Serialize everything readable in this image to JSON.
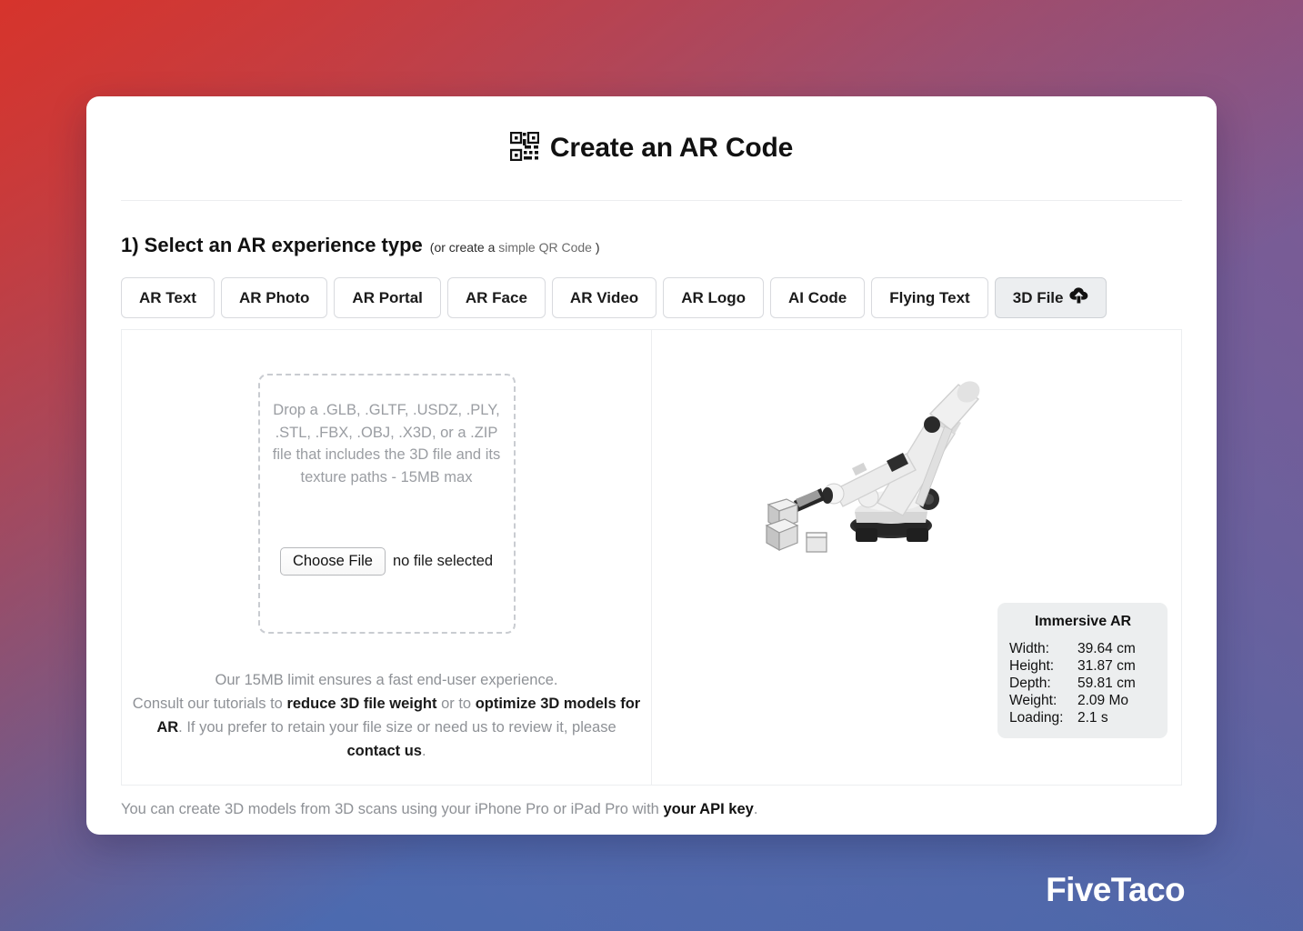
{
  "background": {
    "color_top_left": "#d6342c",
    "color_top_right": "#805891",
    "color_bottom_left": "#446ab2",
    "color_bottom_right": "#5a63a0"
  },
  "header": {
    "icon": "qr-code-icon",
    "title": "Create an AR Code"
  },
  "step": {
    "title": "1) Select an AR experience type",
    "note_prefix": "(or create a ",
    "note_link": "simple QR Code",
    "note_suffix": " )"
  },
  "tabs": [
    {
      "label": "AR Text",
      "active": false,
      "icon": null
    },
    {
      "label": "AR Photo",
      "active": false,
      "icon": null
    },
    {
      "label": "AR Portal",
      "active": false,
      "icon": null
    },
    {
      "label": "AR Face",
      "active": false,
      "icon": null
    },
    {
      "label": "AR Video",
      "active": false,
      "icon": null
    },
    {
      "label": "AR Logo",
      "active": false,
      "icon": null
    },
    {
      "label": "AI Code",
      "active": false,
      "icon": null
    },
    {
      "label": "Flying Text",
      "active": false,
      "icon": null
    },
    {
      "label": "3D File",
      "active": true,
      "icon": "cloud-upload-icon"
    }
  ],
  "dropzone": {
    "instructions": "Drop a .GLB, .GLTF, .USDZ, .PLY, .STL, .FBX, .OBJ, .X3D, or a .ZIP file that includes the 3D file and its texture paths - 15MB max",
    "choose_file_label": "Choose File",
    "file_status": "no file selected"
  },
  "helper": {
    "line1": "Our 15MB limit ensures a fast end-user experience.",
    "line2_part1": "Consult our tutorials to ",
    "link1": "reduce 3D file weight",
    "line2_part2": " or to ",
    "link2": "optimize 3D models for AR",
    "line2_part3": ". If you prefer to retain your file size or need us to review it, please ",
    "link3": "contact us",
    "line2_part4": "."
  },
  "preview": {
    "model_name": "robot-arm-3d-model",
    "info": {
      "title": "Immersive AR",
      "rows": [
        {
          "label": "Width:",
          "value": "39.64  cm"
        },
        {
          "label": "Height:",
          "value": "31.87  cm"
        },
        {
          "label": "Depth:",
          "value": "59.81  cm"
        },
        {
          "label": "Weight:",
          "value": "2.09 Mo"
        },
        {
          "label": "Loading:",
          "value": "2.1 s"
        }
      ]
    }
  },
  "footer": {
    "text_prefix": "You can create 3D models from 3D scans using your iPhone Pro or iPad Pro with ",
    "link": "your API key",
    "text_suffix": "."
  },
  "watermark": {
    "text": "FiveTaco"
  }
}
